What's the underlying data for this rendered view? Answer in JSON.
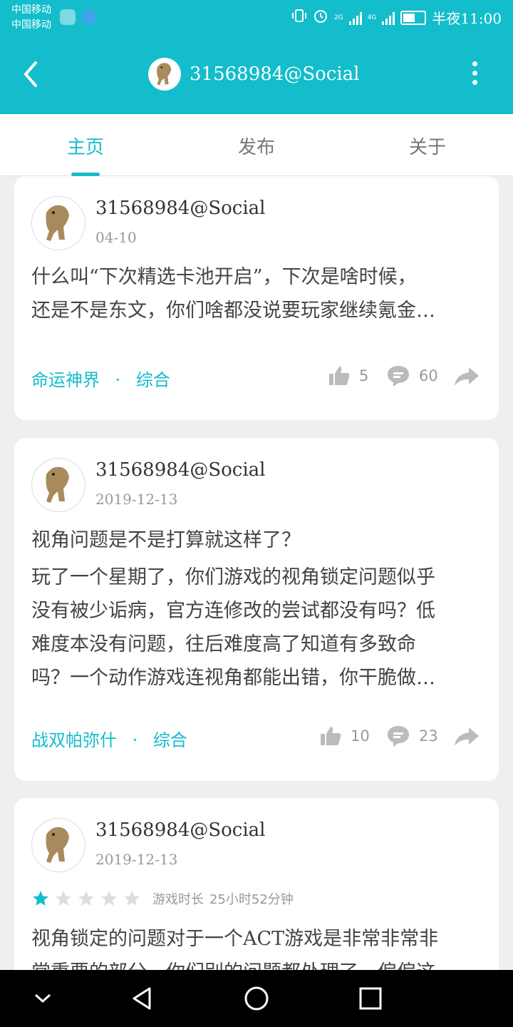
{
  "status_bar": {
    "carrier_1": "中国移动",
    "carrier_2": "中国移动",
    "net_1": "2G",
    "net_2": "4G",
    "time": "半夜11:00"
  },
  "header": {
    "title": "31568984@Social"
  },
  "tabs": [
    {
      "label": "主页",
      "active": true
    },
    {
      "label": "发布",
      "active": false
    },
    {
      "label": "关于",
      "active": false
    }
  ],
  "posts": [
    {
      "username": "31568984@Social",
      "date": "04-10",
      "body": "什么叫“下次精选卡池开启”，下次是啥时候，还是不是东文，你们啥都没说要玩家继续氪金…",
      "body_lines": [
        "什么叫“下次精选卡池开启”，下次是啥时候，",
        "还是不是东文，你们啥都没说要玩家继续氪金…"
      ],
      "game": "命运神界",
      "category": "综合",
      "likes": "5",
      "comments": "60"
    },
    {
      "username": "31568984@Social",
      "date": "2019-12-13",
      "title": "视角问题是不是打算就这样了？",
      "body_lines": [
        "玩了一个星期了，你们游戏的视角锁定问题似乎",
        "没有被少诟病，官方连修改的尝试都没有吗？低",
        "难度本没有问题，往后难度高了知道有多致命",
        "吗？一个动作游戏连视角都能出错，你干脆做…"
      ],
      "game": "战双帕弥什",
      "category": "综合",
      "likes": "10",
      "comments": "23"
    },
    {
      "username": "31568984@Social",
      "date": "2019-12-13",
      "rating": 1,
      "rating_max": 5,
      "playtime_label": "游戏时长",
      "playtime_value": "25小时52分钟",
      "body_lines": [
        "视角锁定的问题对于一个ACT游戏是非常非常非",
        "常重要的部分，你们别的问题都处理了，偏偏这"
      ]
    }
  ],
  "tag_separator": "·",
  "colors": {
    "accent": "#13bdcb",
    "star_on": "#13bdcb",
    "star_off": "#dddddd"
  },
  "icons": [
    "back-arrow-icon",
    "more-vertical-icon",
    "thumbs-up-icon",
    "comment-icon",
    "share-icon",
    "star-icon",
    "nav-back-icon",
    "nav-home-icon",
    "nav-recents-icon",
    "nav-collapse-icon"
  ]
}
